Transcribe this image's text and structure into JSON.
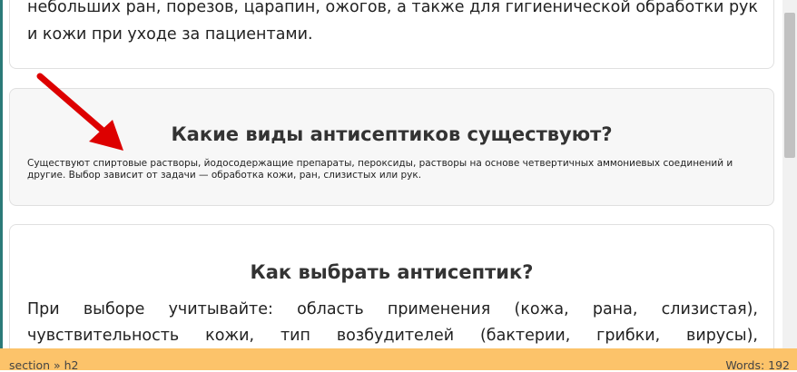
{
  "cards": {
    "first": {
      "text": "небольших ран, порезов, царапин, ожогов, а также для гигиенической обработки рук и кожи при уходе за пациентами."
    },
    "second": {
      "heading": "Какие виды антисептиков существуют?",
      "text": "Существуют спиртовые растворы, йодосодержащие препараты, пероксиды, растворы на основе четвертичных аммониевых соединений и другие. Выбор зависит от задачи — обработка кожи, ран, слизистых или рук."
    },
    "third": {
      "heading": "Как выбрать антисептик?",
      "text": "При выборе учитывайте: область применения (кожа, рана, слизистая), чувствительность кожи, тип возбудителей (бактерии, грибки, вирусы), рекомендуемые концентрации, возможные"
    }
  },
  "status_bar": {
    "path": "section » h2",
    "word_count": "Words: 192"
  },
  "colors": {
    "status_bar": "#fcc36a",
    "arrow": "#dd0000",
    "highlight_card": "#f7f7f7"
  }
}
